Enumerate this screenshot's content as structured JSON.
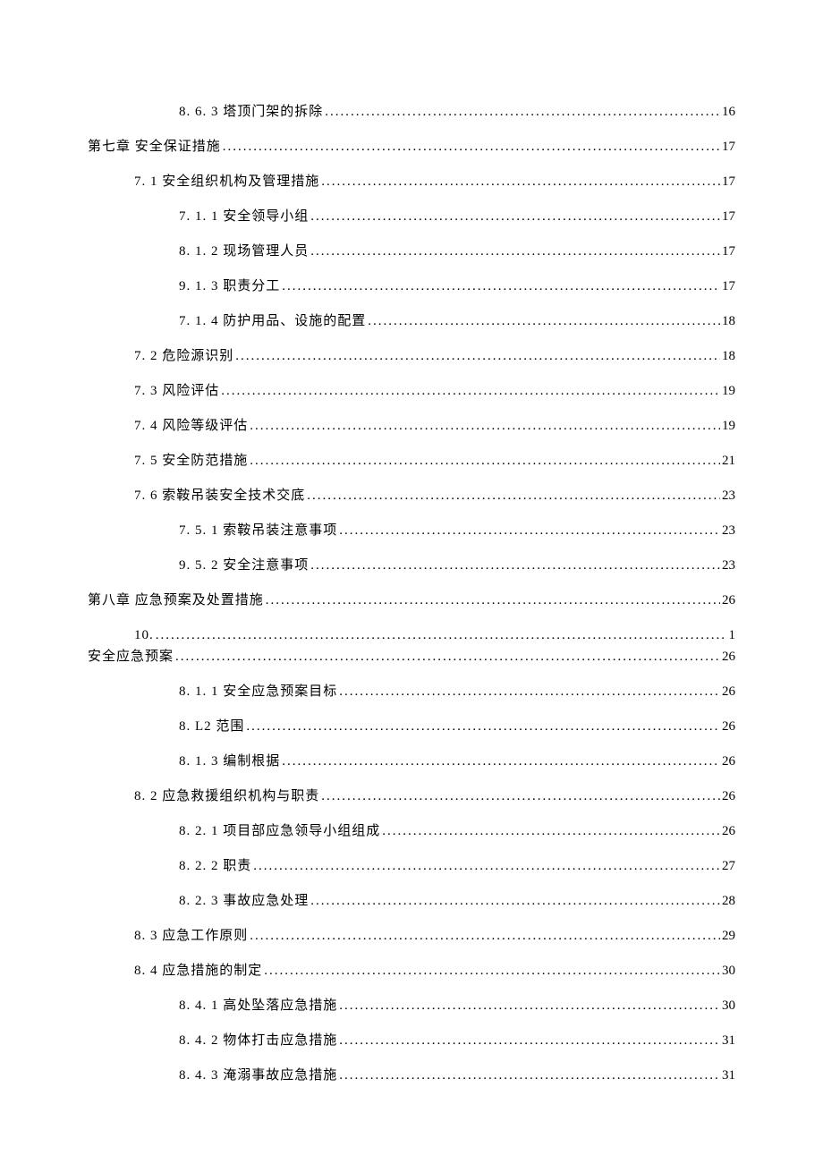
{
  "toc": [
    {
      "indent": "i2",
      "label": "8.  6. 3 塔顶门架的拆除",
      "page": "16"
    },
    {
      "indent": "i0",
      "label": "第七章 安全保证措施",
      "page": "17"
    },
    {
      "indent": "i1",
      "label": "7. 1 安全组织机构及管理措施",
      "page": "17"
    },
    {
      "indent": "i2",
      "label": "7.  1. 1 安全领导小组",
      "page": "17"
    },
    {
      "indent": "i2",
      "label": "8.  1. 2 现场管理人员",
      "page": "17"
    },
    {
      "indent": "i2",
      "label": "9.  1. 3 职责分工",
      "page": "17"
    },
    {
      "indent": "i2",
      "label": "7.  1. 4 防护用品、设施的配置",
      "page": "18"
    },
    {
      "indent": "i1",
      "label": "7.  2 危险源识别",
      "page": "18"
    },
    {
      "indent": "i1",
      "label": "7.  3 风险评估",
      "page": "19"
    },
    {
      "indent": "i1",
      "label": "7.  4 风险等级评估",
      "page": "19"
    },
    {
      "indent": "i1",
      "label": "7.  5 安全防范措施",
      "page": "21"
    },
    {
      "indent": "i1",
      "label": "7.  6 索鞍吊装安全技术交底",
      "page": "23"
    },
    {
      "indent": "i2",
      "label": "7.  5. 1 索鞍吊装注意事项",
      "page": "23"
    },
    {
      "indent": "i2",
      "label": "9.  5. 2 安全注意事项",
      "page": "23"
    },
    {
      "indent": "i0",
      "label": "第八章 应急预案及处置措施",
      "page": "26"
    },
    {
      "indent": "i1",
      "label": "10.",
      "page": "1"
    },
    {
      "indent": "i0",
      "label": "安全应急预案",
      "page": "26",
      "tight": true
    },
    {
      "indent": "i2",
      "label": "8. 1. 1 安全应急预案目标",
      "page": "26"
    },
    {
      "indent": "i2",
      "label": "8. L2 范围",
      "page": "26"
    },
    {
      "indent": "i2",
      "label": "8. 1. 3 编制根据",
      "page": "26"
    },
    {
      "indent": "i1",
      "label": "8. 2 应急救援组织机构与职责",
      "page": "26"
    },
    {
      "indent": "i2",
      "label": "8. 2. 1 项目部应急领导小组组成",
      "page": "26"
    },
    {
      "indent": "i2",
      "label": "8. 2. 2 职责",
      "page": "27"
    },
    {
      "indent": "i2",
      "label": "8. 2. 3 事故应急处理",
      "page": "28"
    },
    {
      "indent": "i1",
      "label": "8. 3 应急工作原则",
      "page": "29"
    },
    {
      "indent": "i1",
      "label": "8. 4 应急措施的制定",
      "page": "30"
    },
    {
      "indent": "i2",
      "label": "8. 4. 1 高处坠落应急措施",
      "page": "30"
    },
    {
      "indent": "i2",
      "label": "8. 4. 2 物体打击应急措施",
      "page": "31"
    },
    {
      "indent": "i2",
      "label": "8. 4. 3 淹溺事故应急措施",
      "page": "31"
    }
  ]
}
